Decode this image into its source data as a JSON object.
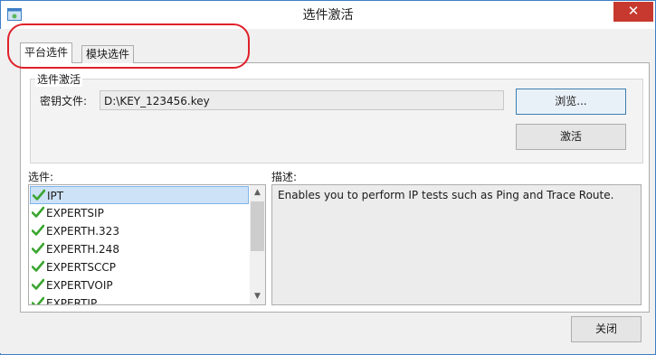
{
  "window": {
    "title": "选件激活",
    "close_glyph": "✕"
  },
  "tabs": [
    {
      "label": "平台选件",
      "active": true
    },
    {
      "label": "模块选件",
      "active": false
    }
  ],
  "activation": {
    "legend": "选件激活",
    "key_label": "密钥文件:",
    "key_value": "D:\\KEY_123456.key",
    "browse_label": "浏览...",
    "activate_label": "激活"
  },
  "options": {
    "label": "选件:",
    "items": [
      {
        "name": "IPT",
        "checked": true,
        "selected": true
      },
      {
        "name": "EXPERTSIP",
        "checked": true
      },
      {
        "name": "EXPERTH.323",
        "checked": true
      },
      {
        "name": "EXPERTH.248",
        "checked": true
      },
      {
        "name": "EXPERTSCCP",
        "checked": true
      },
      {
        "name": "EXPERTVOIP",
        "checked": true
      },
      {
        "name": "EXPERTIP",
        "checked": true
      }
    ]
  },
  "description": {
    "label": "描述:",
    "text": "Enables you to perform IP tests such as Ping and Trace Route."
  },
  "footer": {
    "close_label": "关闭"
  },
  "scroll": {
    "up_glyph": "▲",
    "down_glyph": "▼"
  },
  "colors": {
    "accent": "#3e7fc6",
    "close": "#c7392e",
    "highlight_ring": "#e0202a",
    "check": "#3aa52f",
    "selection": "#cde2f7"
  },
  "icons": {
    "app": "app-window-icon",
    "check": "green-check-icon"
  }
}
